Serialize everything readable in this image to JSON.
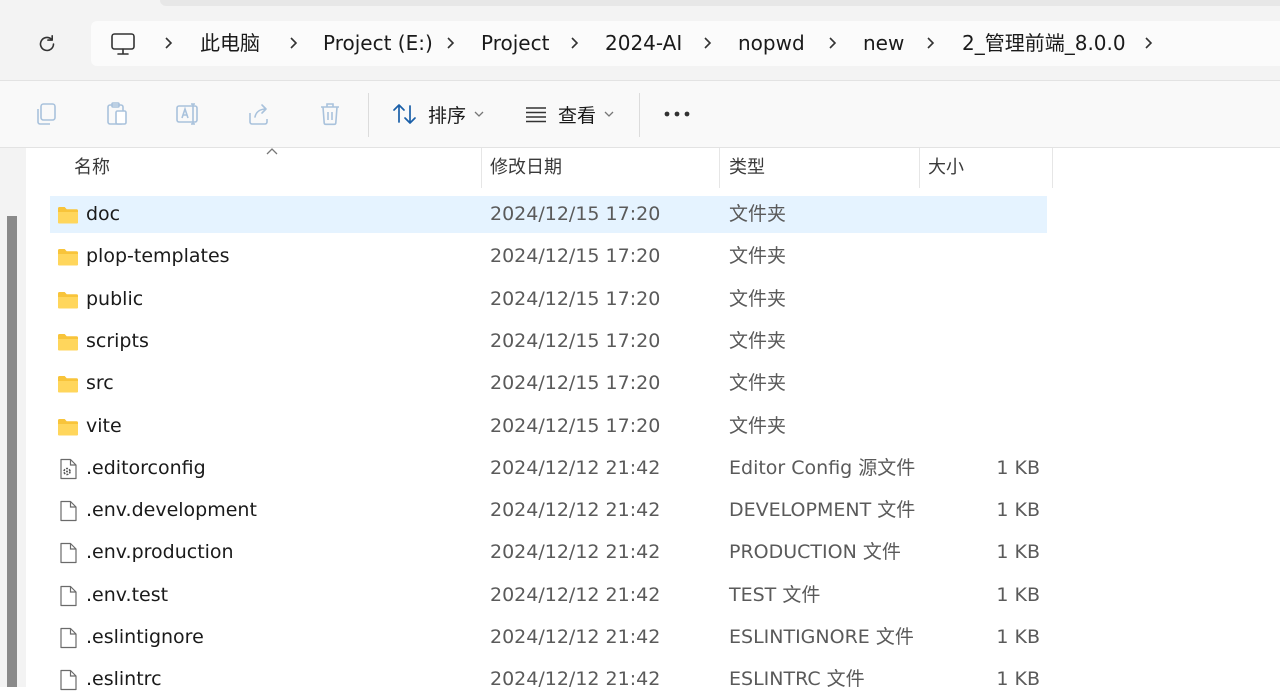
{
  "address_bar": {
    "breadcrumbs": [
      "此电脑",
      "Project (E:)",
      "Project",
      "2024-AI",
      "nopwd",
      "new",
      "2_管理前端_8.0.0"
    ]
  },
  "command_bar": {
    "sort_label": "排序",
    "view_label": "查看",
    "more_label": "•••"
  },
  "columns": {
    "name": "名称",
    "modified": "修改日期",
    "type": "类型",
    "size": "大小"
  },
  "files": [
    {
      "name": "doc",
      "modified": "2024/12/15 17:20",
      "type": "文件夹",
      "size": "",
      "icon": "folder-icon",
      "selected": true
    },
    {
      "name": "plop-templates",
      "modified": "2024/12/15 17:20",
      "type": "文件夹",
      "size": "",
      "icon": "folder-icon"
    },
    {
      "name": "public",
      "modified": "2024/12/15 17:20",
      "type": "文件夹",
      "size": "",
      "icon": "folder-icon"
    },
    {
      "name": "scripts",
      "modified": "2024/12/15 17:20",
      "type": "文件夹",
      "size": "",
      "icon": "folder-icon"
    },
    {
      "name": "src",
      "modified": "2024/12/15 17:20",
      "type": "文件夹",
      "size": "",
      "icon": "folder-icon"
    },
    {
      "name": "vite",
      "modified": "2024/12/15 17:20",
      "type": "文件夹",
      "size": "",
      "icon": "folder-icon"
    },
    {
      "name": ".editorconfig",
      "modified": "2024/12/12 21:42",
      "type": "Editor Config 源文件",
      "size": "1 KB",
      "icon": "config-file-icon"
    },
    {
      "name": ".env.development",
      "modified": "2024/12/12 21:42",
      "type": "DEVELOPMENT 文件",
      "size": "1 KB",
      "icon": "file-icon"
    },
    {
      "name": ".env.production",
      "modified": "2024/12/12 21:42",
      "type": "PRODUCTION 文件",
      "size": "1 KB",
      "icon": "file-icon"
    },
    {
      "name": ".env.test",
      "modified": "2024/12/12 21:42",
      "type": "TEST 文件",
      "size": "1 KB",
      "icon": "file-icon"
    },
    {
      "name": ".eslintignore",
      "modified": "2024/12/12 21:42",
      "type": "ESLINTIGNORE 文件",
      "size": "1 KB",
      "icon": "file-icon"
    },
    {
      "name": ".eslintrc",
      "modified": "2024/12/12 21:42",
      "type": "ESLINTRC 文件",
      "size": "1 KB",
      "icon": "file-icon"
    }
  ],
  "colors": {
    "selection": "#e5f3ff",
    "folder": "#f8c43a"
  }
}
